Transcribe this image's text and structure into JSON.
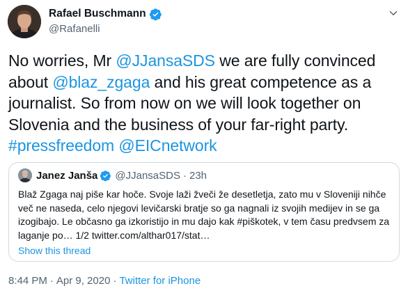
{
  "author": {
    "name": "Rafael Buschmann",
    "handle": "@Rafanelli"
  },
  "tweet": {
    "segments": [
      {
        "text": "No worries, Mr ",
        "link": false
      },
      {
        "text": "@JJansaSDS",
        "link": true
      },
      {
        "text": " we are fully convinced about ",
        "link": false
      },
      {
        "text": "@blaz_zgaga",
        "link": true
      },
      {
        "text": " and his great competence as a journalist. So from now on we will look together on Slovenia and the business of your far-right party. ",
        "link": false
      },
      {
        "text": "#pressfreedom",
        "link": true
      },
      {
        "text": " ",
        "link": false
      },
      {
        "text": "@EICnetwork",
        "link": true
      }
    ]
  },
  "quoted": {
    "name": "Janez Janša",
    "handle": "@JJansaSDS",
    "dot": "·",
    "time": "23h",
    "text": "Blaž Zgaga naj piše kar hoče. Svoje laži žveči že desetletja, zato mu v Sloveniji nihče več ne naseda, celo njegovi levičarski bratje so ga nagnali iz svojih medijev in se ga izogibajo. Le občasno ga izkoristijo in mu dajo kak #piškotek, v tem času predvsem za laganje po…  1/2 twitter.com/althar017/stat…",
    "show_thread": "Show this thread"
  },
  "meta": {
    "time": "8:44 PM",
    "sep1": "·",
    "date": "Apr 9, 2020",
    "sep2": "·",
    "source": "Twitter for iPhone"
  },
  "colors": {
    "link": "#1b95e0",
    "verified": "#1d9bf0",
    "muted": "#536471",
    "border": "#cfd9de"
  },
  "icons": {
    "verified": "verified-badge-icon",
    "more": "chevron-down-icon"
  }
}
